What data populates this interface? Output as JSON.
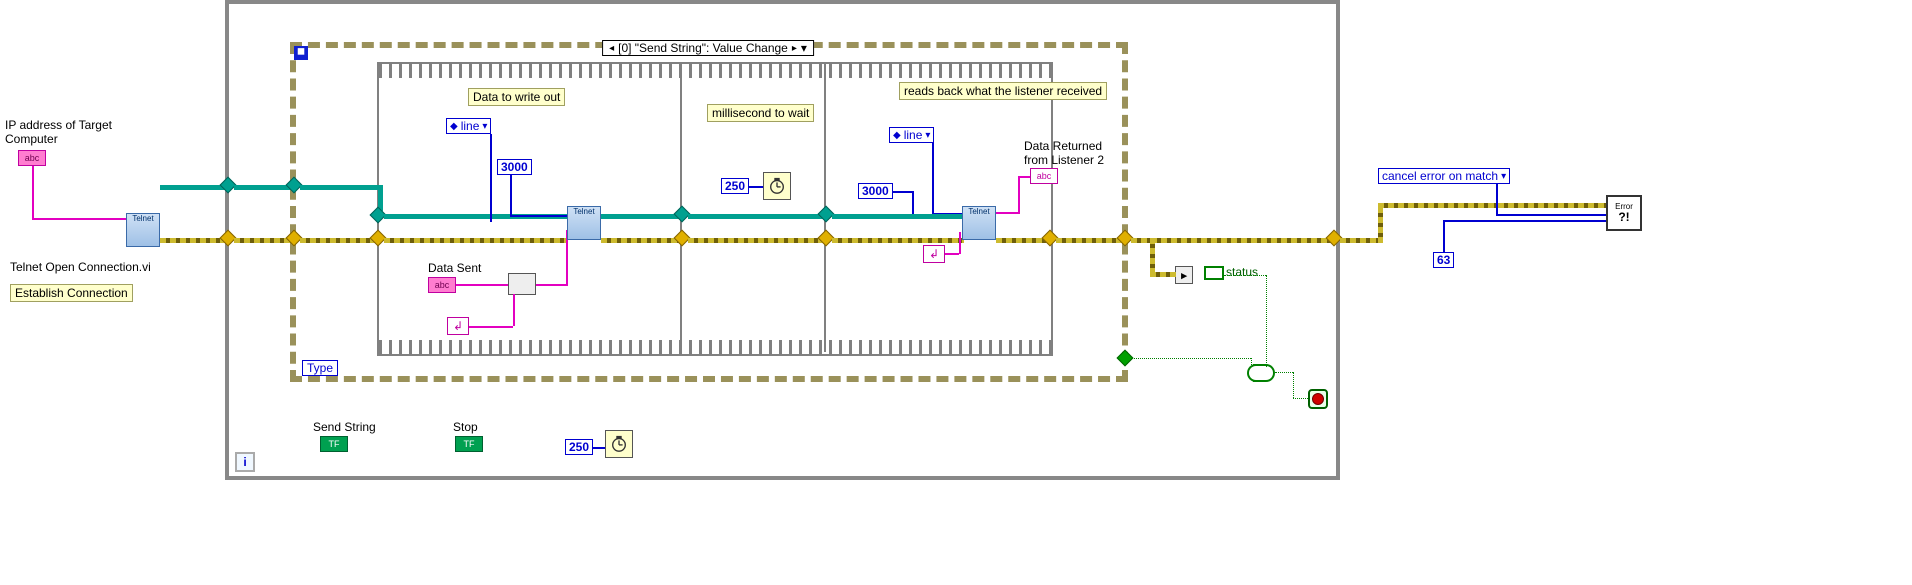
{
  "left": {
    "ip_label": "IP address of Target\nComputer",
    "telnet_caption": "Telnet Open Connection.vi",
    "establish_comment": "Establish Connection"
  },
  "event": {
    "case_label": "[0] \"Send String\": Value Change",
    "type_label": "Type"
  },
  "frame1": {
    "comment": "Data to write out",
    "read_mode": "line",
    "timeout": "3000",
    "data_sent_label": "Data Sent"
  },
  "frame2": {
    "comment": "millisecond to wait",
    "wait_ms": "250"
  },
  "frame3": {
    "comment": "reads back what the listener\nreceived",
    "read_mode": "line",
    "timeout": "3000",
    "data_returned_label": "Data Returned\nfrom Listener 2"
  },
  "bottom": {
    "send_string_label": "Send String",
    "stop_label": "Stop",
    "loop_wait_ms": "250"
  },
  "right": {
    "status_label": "status",
    "cancel_error_ring": "cancel error on match",
    "error_code": "63",
    "error_icon_text": "Error"
  }
}
